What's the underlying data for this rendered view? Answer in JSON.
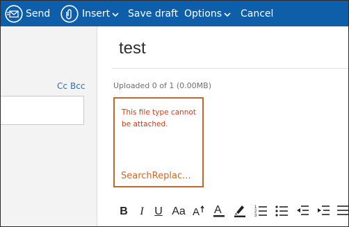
{
  "toolbar": {
    "send_label": "Send",
    "insert_label": "Insert",
    "save_draft_label": "Save draft",
    "options_label": "Options",
    "cancel_label": "Cancel"
  },
  "recipients": {
    "cc_label": "Cc",
    "bcc_label": "Bcc"
  },
  "compose": {
    "subject": "test",
    "upload_status": "Uploaded 0 of 1 (0.00MB)"
  },
  "attachment": {
    "error": "This file type cannot be attached.",
    "name": "SearchReplac..."
  },
  "format": {
    "bold": "B",
    "italic": "I",
    "underline": "U",
    "font_size": "Aa"
  },
  "colors": {
    "toolbar_bg": "#0f5eaa",
    "attachment_border": "#c0682c",
    "error_text": "#cc3a1f",
    "link": "#2e6fb0"
  },
  "icons": [
    "send-icon",
    "paperclip-icon",
    "chevron-down-icon",
    "superscript-icon",
    "font-color-icon",
    "highlight-icon",
    "numbered-list-icon",
    "bulleted-list-icon",
    "decrease-indent-icon",
    "increase-indent-icon",
    "align-icon"
  ]
}
